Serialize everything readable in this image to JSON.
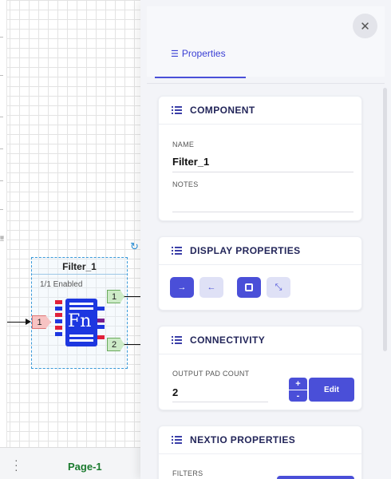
{
  "canvas": {
    "node": {
      "title": "Filter_1",
      "status": "1/1 Enabled",
      "fn_label": "Fn",
      "input_pad": "1",
      "output_pads": [
        "1",
        "2"
      ]
    }
  },
  "bottom_bar": {
    "menu_icon": "kebab-icon",
    "page_tab": "Page-1"
  },
  "panel": {
    "close_icon": "close-icon",
    "tab": {
      "icon": "list-icon",
      "label": "Properties"
    },
    "sections": {
      "component": {
        "title": "COMPONENT",
        "name_label": "NAME",
        "name_value": "Filter_1",
        "notes_label": "NOTES",
        "notes_value": ""
      },
      "display": {
        "title": "DISPLAY PROPERTIES",
        "buttons": [
          "arrow-right-icon",
          "arrow-left-icon",
          "square-icon",
          "collapse-icon"
        ]
      },
      "connectivity": {
        "title": "CONNECTIVITY",
        "pad_count_label": "OUTPUT PAD COUNT",
        "pad_count_value": "2",
        "increment": "+",
        "decrement": "-",
        "edit_label": "Edit"
      },
      "nextio": {
        "title": "NEXTIO PROPERTIES",
        "filters_label": "FILTERS"
      }
    }
  },
  "colors": {
    "accent": "#4a4fd8",
    "node_fill": "#1d37e0",
    "page_tab": "#1a7a2e"
  }
}
